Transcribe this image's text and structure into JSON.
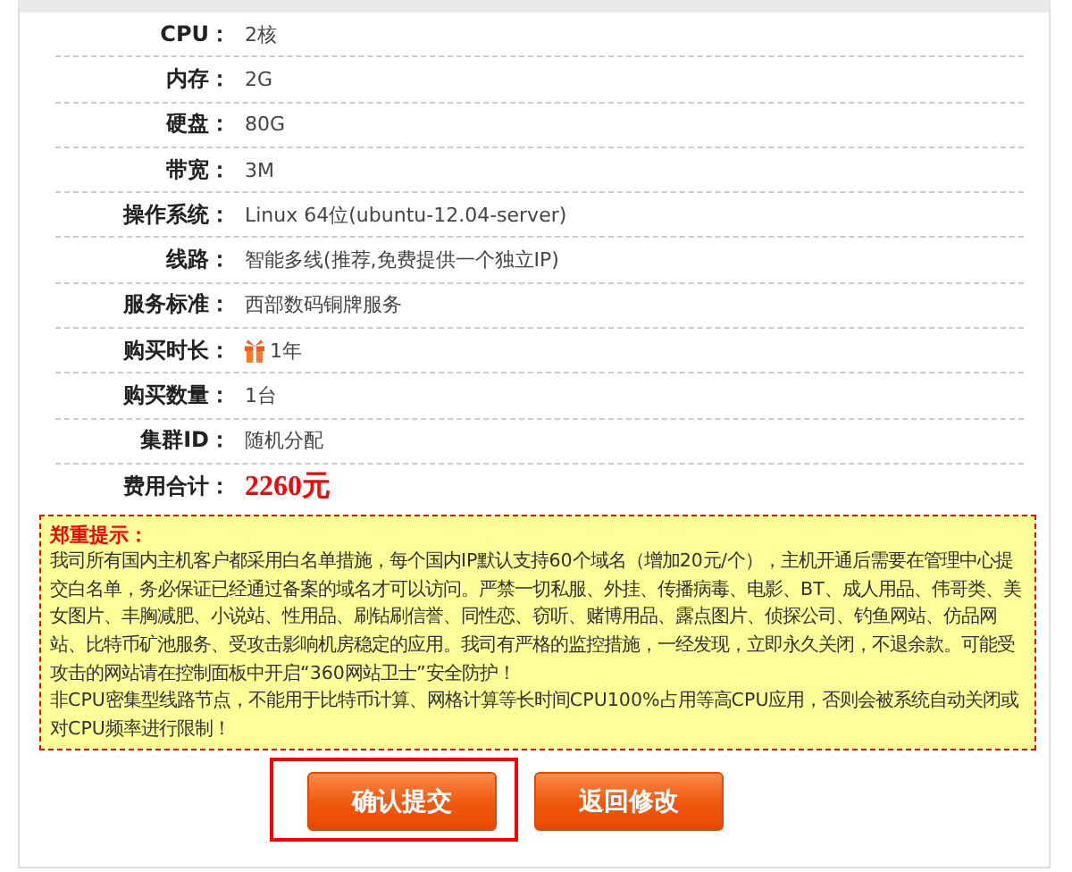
{
  "specs": [
    {
      "label": "CPU：",
      "value": "2核",
      "kind": "text"
    },
    {
      "label": "内存：",
      "value": "2G",
      "kind": "text"
    },
    {
      "label": "硬盘：",
      "value": "80G",
      "kind": "text"
    },
    {
      "label": "带宽：",
      "value": "3M",
      "kind": "text"
    },
    {
      "label": "操作系统：",
      "value": "Linux 64位(ubuntu-12.04-server)",
      "kind": "text"
    },
    {
      "label": "线路：",
      "value": "智能多线(推荐,免费提供一个独立IP)",
      "kind": "text"
    },
    {
      "label": "服务标准：",
      "value": "西部数码铜牌服务",
      "kind": "text"
    },
    {
      "label": "购买时长：",
      "value": "1年",
      "kind": "gift"
    },
    {
      "label": "购买数量：",
      "value": "1台",
      "kind": "text"
    },
    {
      "label": "集群ID：",
      "value": "随机分配",
      "kind": "text"
    },
    {
      "label": "费用合计：",
      "value": "2260元",
      "kind": "price"
    }
  ],
  "notice": {
    "title": "郑重提示：",
    "paragraphs": [
      "我司所有国内主机客户都采用白名单措施，每个国内IP默认支持60个域名（增加20元/个），主机开通后需要在管理中心提交白名单，务必保证已经通过备案的域名才可以访问。严禁一切私服、外挂、传播病毒、电影、BT、成人用品、伟哥类、美女图片、丰胸减肥、小说站、性用品、刷钻刷信誉、同性恋、窃听、赌博用品、露点图片、侦探公司、钓鱼网站、仿品网站、比特币矿池服务、受攻击影响机房稳定的应用。我司有严格的监控措施，一经发现，立即永久关闭，不退余款。可能受攻击的网站请在控制面板中开启“360网站卫士”安全防护！",
      "非CPU密集型线路节点，不能用于比特币计算、网格计算等长时间CPU100%占用等高CPU应用，否则会被系统自动关闭或对CPU频率进行限制！"
    ]
  },
  "buttons": [
    {
      "label": "确认提交",
      "highlighted": true
    },
    {
      "label": "返回修改",
      "highlighted": false
    }
  ]
}
